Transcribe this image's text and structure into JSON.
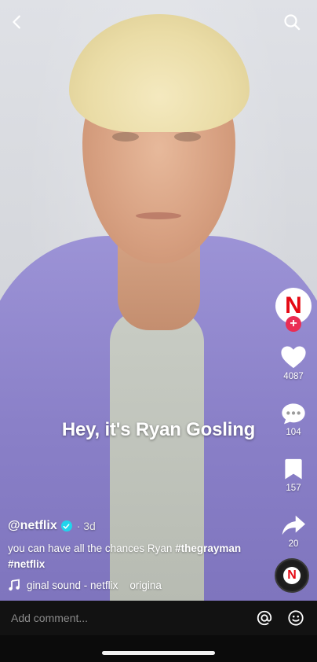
{
  "topbar": {
    "back_icon": "chevron-left-icon",
    "search_icon": "search-icon"
  },
  "caption": "Hey, it's Ryan Gosling",
  "rail": {
    "avatar_letter": "N",
    "likes": "4087",
    "comments": "104",
    "saves": "157",
    "shares": "20"
  },
  "post": {
    "username": "@netflix",
    "time": "· 3d",
    "desc_text": "you can have all the chances Ryan ",
    "tag1": "#thegrayman",
    "tag2": "#netflix",
    "sound": "ginal sound - netflix    origina"
  },
  "comment_bar": {
    "placeholder": "Add comment..."
  },
  "colors": {
    "accent": "#ea2d54",
    "netflix_red": "#e50914",
    "verified": "#20d5ec"
  }
}
